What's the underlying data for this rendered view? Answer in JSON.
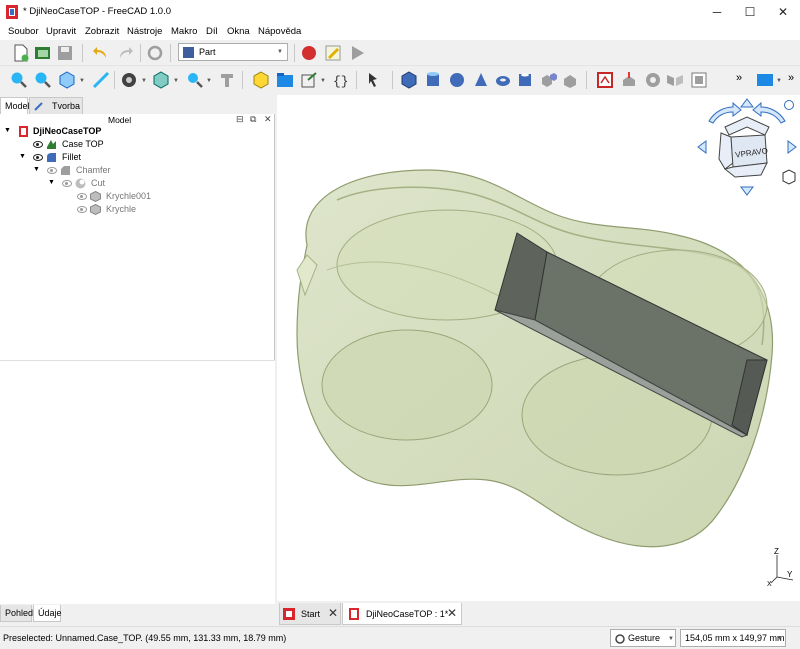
{
  "window": {
    "title": "* DjiNeoCaseTOP - FreeCAD 1.0.0",
    "minimize": "─",
    "maximize": "☐",
    "close": "✕"
  },
  "menu": [
    "Soubor",
    "Upravit",
    "Zobrazit",
    "Nástroje",
    "Makro",
    "Díl",
    "Okna",
    "Nápověda"
  ],
  "toolbar": {
    "workbench": "Part",
    "overflow": "»"
  },
  "combo": {
    "tabs": [
      "Model",
      "Tvorba"
    ],
    "header": "Model"
  },
  "tree": [
    {
      "label": "DjiNeoCaseTOP",
      "bold": true
    },
    {
      "label": "Case TOP"
    },
    {
      "label": "Fillet"
    },
    {
      "label": "Chamfer"
    },
    {
      "label": "Cut"
    },
    {
      "label": "Krychle001"
    },
    {
      "label": "Krychle"
    }
  ],
  "bottom_tabs": [
    "Pohled",
    "Údaje"
  ],
  "navcube": {
    "face": "VPRAVO"
  },
  "axes": {
    "x": "X",
    "y": "Y",
    "z": "Z"
  },
  "doc_tabs": [
    {
      "label": "Start",
      "close": "✕"
    },
    {
      "label": "DjiNeoCaseTOP : 1*",
      "close": "✕"
    }
  ],
  "status": {
    "message": "Preselected: Unnamed.Case_TOP. (49.55 mm, 131.33 mm, 18.79 mm)",
    "navigation": "Gesture",
    "dimensions": "154,05 mm x 149,97 mm"
  },
  "colors": {
    "model_fill": "#cfd9b4",
    "model_edge": "#8f9c6e",
    "slot_fill": "#5e645b",
    "navcube_accent": "#2f6fc0"
  }
}
